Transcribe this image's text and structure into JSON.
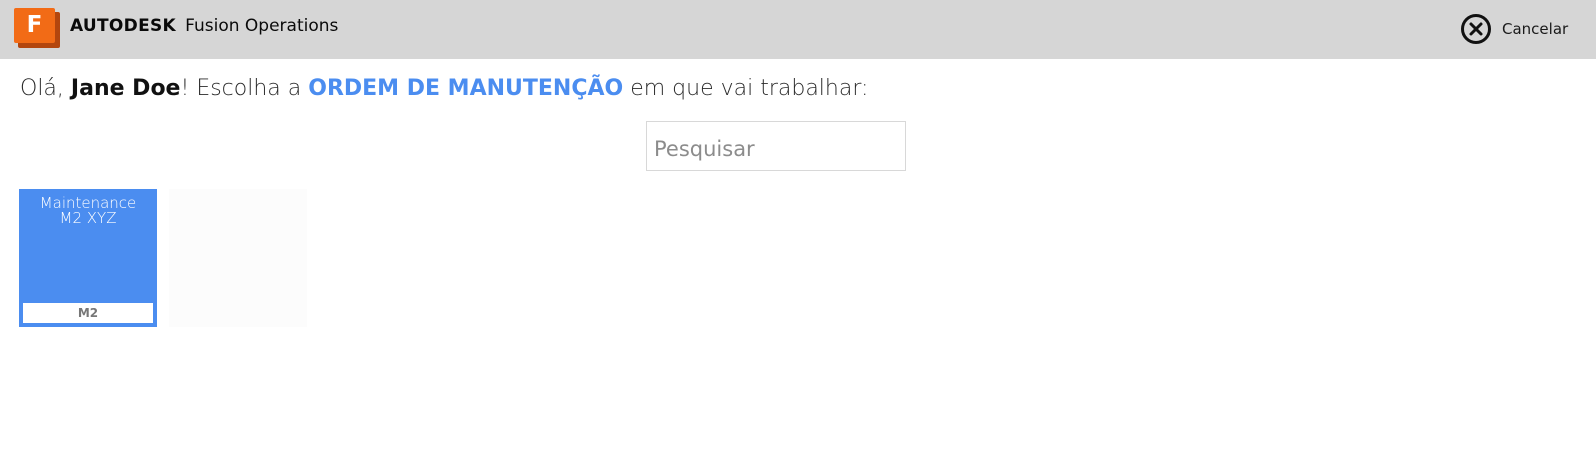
{
  "header": {
    "logo_letter": "F",
    "brand_strong": "AUTODESK",
    "brand_light": "Fusion Operations",
    "cancel_label": "Cancelar",
    "cancel_icon": "close-circle-icon"
  },
  "greeting": {
    "hello": "Olá,",
    "user_name": "Jane Doe",
    "exclaim": "!",
    "prompt_before": "Escolha a",
    "highlight": "ORDEM DE MANUTENÇÃO",
    "prompt_after": "em que vai trabalhar:"
  },
  "search": {
    "placeholder": "Pesquisar",
    "value": ""
  },
  "orders": [
    {
      "title_line1": "Maintenance",
      "title_line2": "M2 XYZ",
      "code": "M2"
    }
  ],
  "colors": {
    "accent": "#4b8df0",
    "header_bg": "#d6d6d6",
    "logo_orange": "#f26b16"
  }
}
